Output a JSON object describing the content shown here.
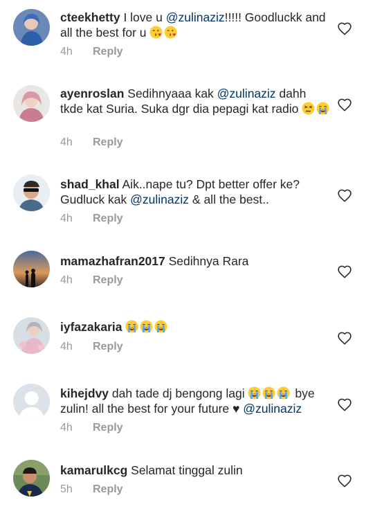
{
  "comments": [
    {
      "username": "cteekhetty",
      "parts": [
        {
          "t": "text",
          "v": " I love u "
        },
        {
          "t": "mention",
          "v": "@zulinaziz"
        },
        {
          "t": "text",
          "v": "!!!!! Goodluckk and all the best for u "
        },
        {
          "t": "emoji",
          "v": "face-blowing-kiss"
        },
        {
          "t": "emoji",
          "v": "face-blowing-kiss"
        }
      ],
      "time": "4h",
      "reply": "Reply"
    },
    {
      "username": "ayenroslan",
      "parts": [
        {
          "t": "text",
          "v": " Sedihnyaaa kak "
        },
        {
          "t": "mention",
          "v": "@zulinaziz"
        },
        {
          "t": "text",
          "v": " dahh tkde kat Suria. Suka dgr dia pepagi kat radio "
        },
        {
          "t": "emoji",
          "v": "persevering-face"
        },
        {
          "t": "emoji",
          "v": "loudly-crying-face"
        }
      ],
      "time": "4h",
      "reply": "Reply"
    },
    {
      "username": "shad_khal",
      "parts": [
        {
          "t": "text",
          "v": " Aik..nape tu? Dpt better offer ke? Gudluck kak "
        },
        {
          "t": "mention",
          "v": "@zulinaziz"
        },
        {
          "t": "text",
          "v": " & all the best.."
        }
      ],
      "time": "4h",
      "reply": "Reply"
    },
    {
      "username": "mamazhafran2017",
      "parts": [
        {
          "t": "text",
          "v": " Sedihnya Rara"
        }
      ],
      "time": "4h",
      "reply": "Reply"
    },
    {
      "username": "iyfazakaria",
      "parts": [
        {
          "t": "text",
          "v": " "
        },
        {
          "t": "emoji",
          "v": "loudly-crying-face"
        },
        {
          "t": "emoji",
          "v": "loudly-crying-face"
        },
        {
          "t": "emoji",
          "v": "loudly-crying-face"
        }
      ],
      "time": "4h",
      "reply": "Reply"
    },
    {
      "username": "kihejdvy",
      "parts": [
        {
          "t": "text",
          "v": " dah tade dj bengong lagi "
        },
        {
          "t": "emoji",
          "v": "loudly-crying-face"
        },
        {
          "t": "emoji",
          "v": "loudly-crying-face"
        },
        {
          "t": "emoji",
          "v": "loudly-crying-face"
        },
        {
          "t": "text",
          "v": " bye zulin! all the best for your future ♥ "
        },
        {
          "t": "mention",
          "v": "@zulinaziz"
        }
      ],
      "time": "4h",
      "reply": "Reply"
    },
    {
      "username": "kamarulkcg",
      "parts": [
        {
          "t": "text",
          "v": " Selamat tinggal zulin"
        }
      ],
      "time": "5h",
      "reply": "Reply"
    }
  ],
  "icons": {
    "like": "heart-outline-icon"
  },
  "colors": {
    "text": "#262626",
    "mention": "#003569",
    "meta": "#999999",
    "heart_stroke": "#262626"
  }
}
